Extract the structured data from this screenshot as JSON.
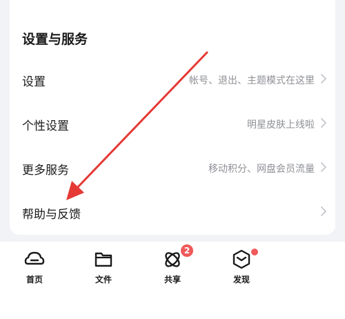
{
  "settings_section": {
    "title": "设置与服务",
    "items": [
      {
        "label": "设置",
        "description": "帐号、退出、主题模式在这里",
        "icon": "chevron-right-icon"
      },
      {
        "label": "个性设置",
        "description": "明星皮肤上线啦",
        "icon": "chevron-right-icon"
      },
      {
        "label": "更多服务",
        "description": "移动积分、网盘会员流量",
        "icon": "chevron-right-icon"
      },
      {
        "label": "帮助与反馈",
        "description": "",
        "icon": "chevron-right-icon"
      }
    ]
  },
  "tabbar": {
    "tabs": [
      {
        "label": "首页",
        "icon": "home-cloud-icon"
      },
      {
        "label": "文件",
        "icon": "folder-icon"
      },
      {
        "label": "共享",
        "icon": "share-orbit-icon",
        "badge": "2"
      },
      {
        "label": "发现",
        "icon": "discover-cube-icon",
        "dot": true
      }
    ]
  },
  "colors": {
    "accent_red": "#e53935",
    "badge": "#ef5a5a",
    "secondary_text": "#8e9095",
    "background": "#f2f3f6"
  }
}
